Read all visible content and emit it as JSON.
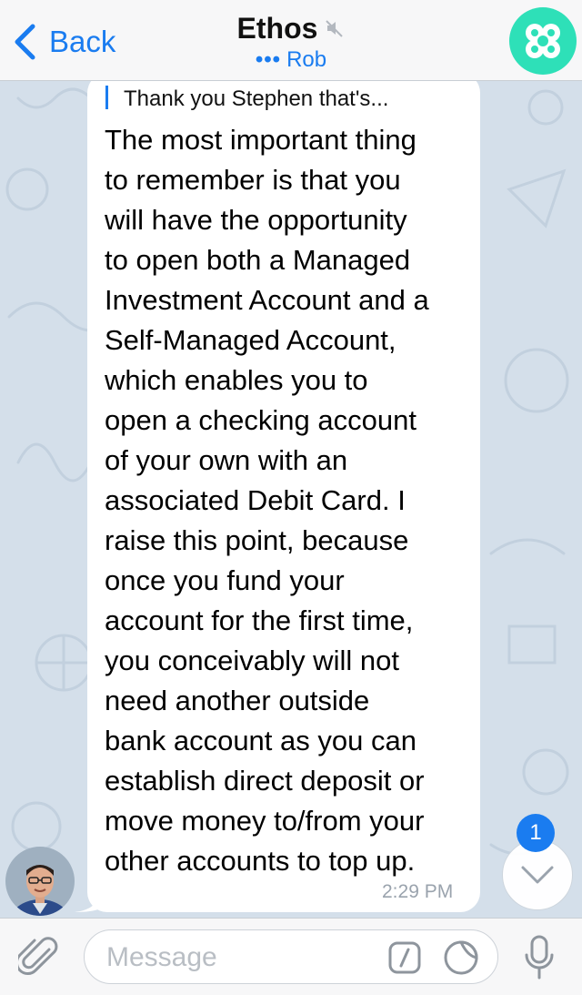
{
  "header": {
    "back_label": "Back",
    "title": "Ethos",
    "typing_dots": "•••",
    "subtitle_user": "Rob",
    "group_avatar_color": "#2ee0b8"
  },
  "message": {
    "reply_preview": "Thank you Stephen that's...",
    "lines": [
      "The most important thing",
      "to remember is that you",
      "will have the opportunity",
      "to open both a Managed",
      "Investment Account and a",
      "Self-Managed Account,",
      "which enables you to",
      "open a checking account",
      "of your own with an",
      "associated Debit Card. I",
      "raise this point, because",
      "once you fund your",
      "account for the first time,",
      "you conceivably will not",
      "need another outside",
      "bank account as you can",
      "establish direct deposit or",
      "move money to/from your",
      "other accounts to top up."
    ],
    "time": "2:29 PM"
  },
  "unread_count": "1",
  "input": {
    "placeholder": "Message"
  },
  "colors": {
    "accent": "#1a7cf0",
    "chat_background": "#d4dfea"
  }
}
